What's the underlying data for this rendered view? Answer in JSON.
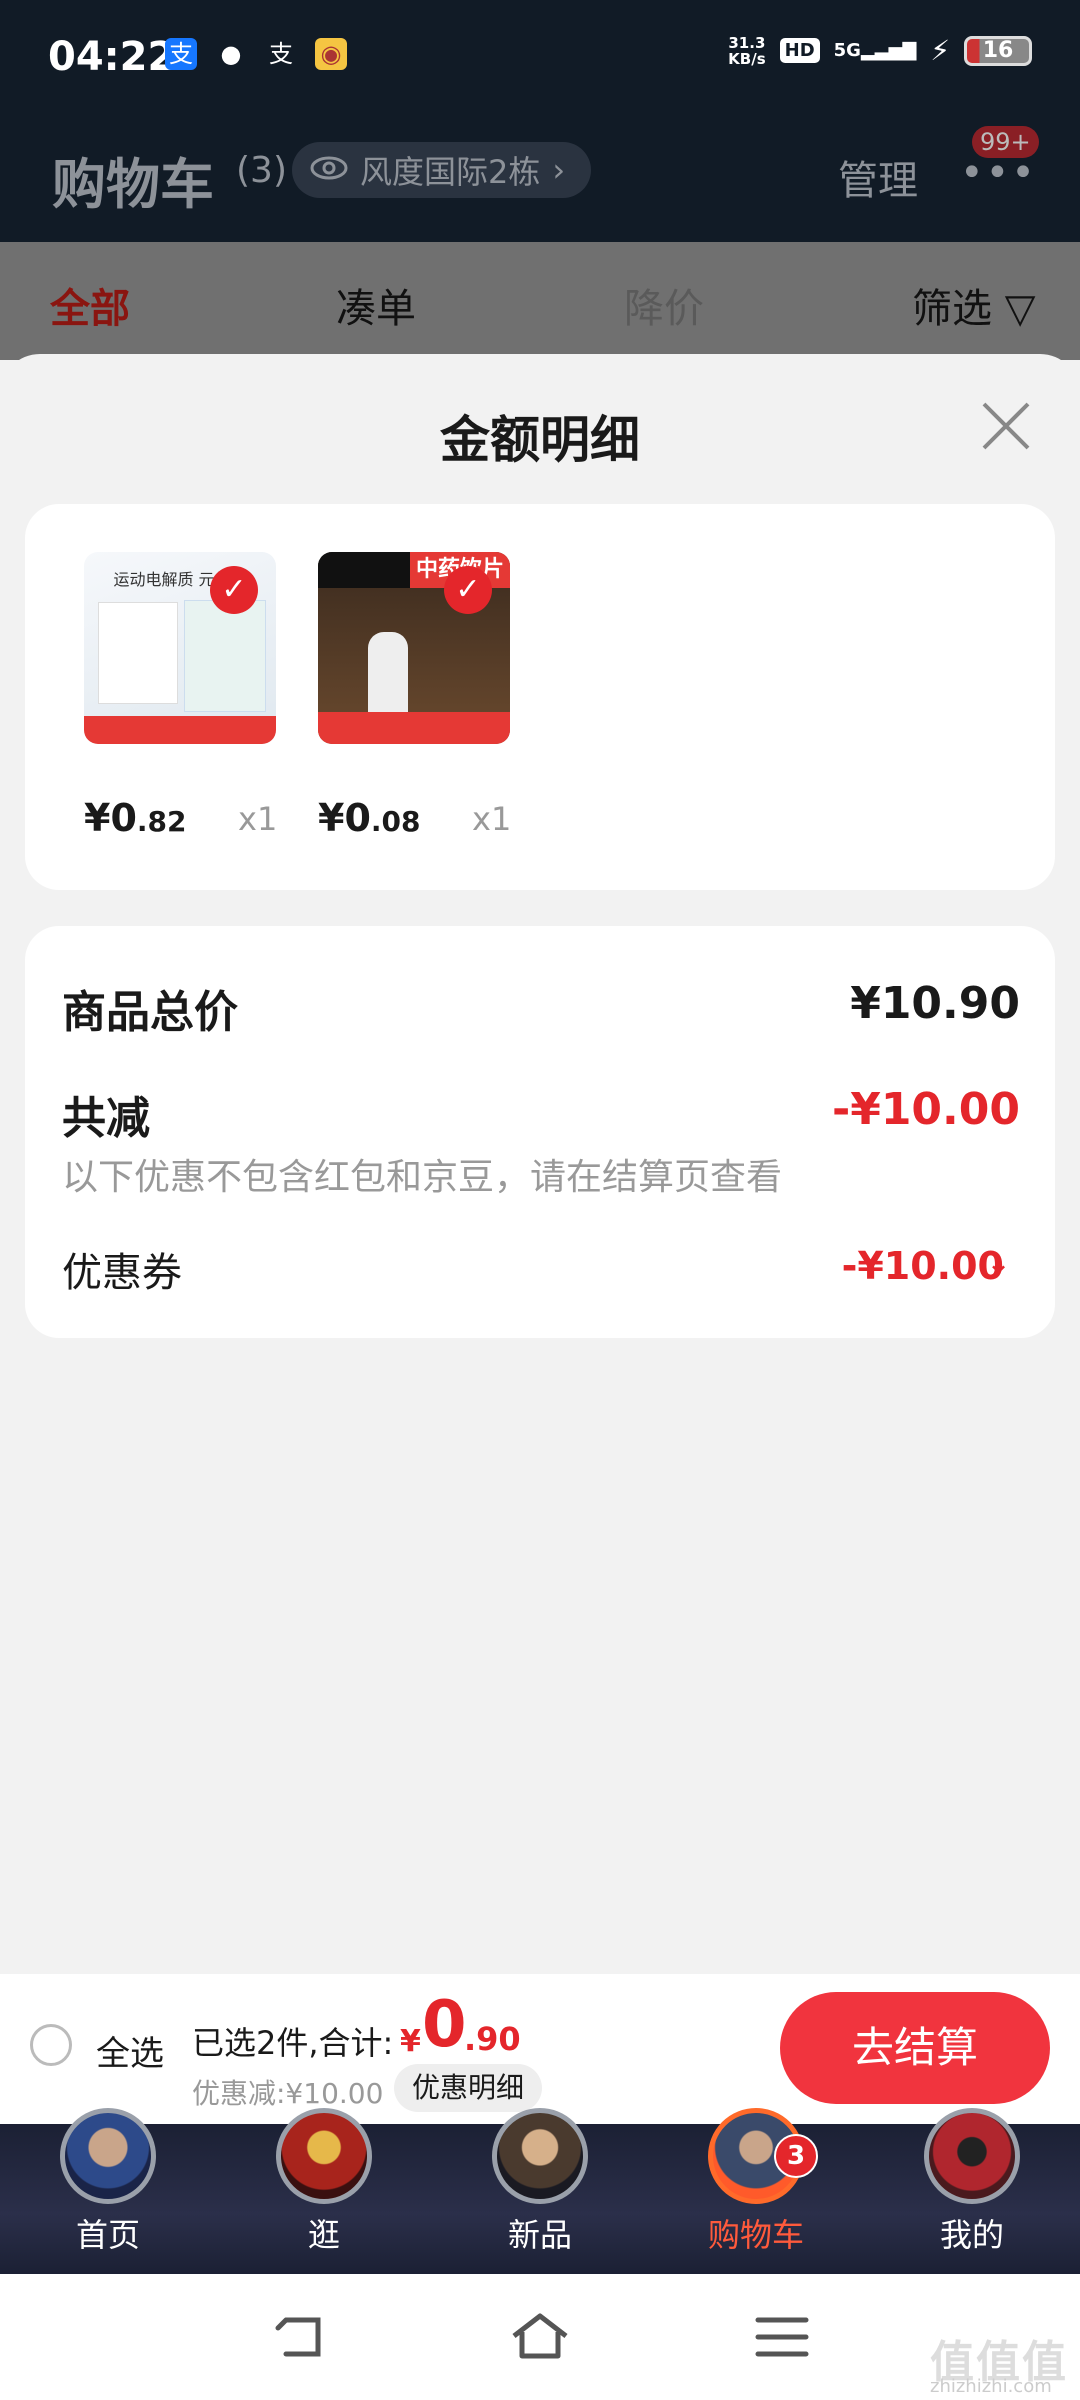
{
  "status_bar": {
    "time": "04:22",
    "net_speed_top": "31.3",
    "net_speed_unit": "KB/s",
    "hd": "HD",
    "signal": "5G",
    "battery": "16"
  },
  "header": {
    "title": "购物车",
    "count": "(3)",
    "address": "风度国际2栋",
    "manage": "管理",
    "more": "•••",
    "badge": "99+"
  },
  "tabs": [
    {
      "label": "全部"
    },
    {
      "label": "凑单"
    },
    {
      "label": "降价"
    },
    {
      "label": "筛选"
    }
  ],
  "sheet": {
    "title": "金额明细",
    "items": [
      {
        "price_yen": "¥0",
        "price_dec": ".82",
        "qty": "x1",
        "img_label": "运动电解质 元气补"
      },
      {
        "price_yen": "¥0",
        "price_dec": ".08",
        "qty": "x1",
        "img_label": "中药饮片"
      }
    ],
    "summary": {
      "goods_total_label": "商品总价",
      "goods_total": "¥10.90",
      "reduce_label": "共减",
      "reduce_value": "-¥10.00",
      "note": "以下优惠不包含红包和京豆，请在结算页查看",
      "coupon_label": "优惠券",
      "coupon_value": "-¥10.00"
    }
  },
  "checkout": {
    "select_all": "全选",
    "selected_summary": "已选2件,合计:",
    "total_yen": "¥",
    "total_int": "0",
    "total_dec": ".90",
    "discount": "优惠减:¥10.00",
    "detail_button": "优惠明细",
    "checkout_button": "去结算"
  },
  "bottom_nav": [
    {
      "label": "首页"
    },
    {
      "label": "逛"
    },
    {
      "label": "新品"
    },
    {
      "label": "购物车",
      "badge": "3"
    },
    {
      "label": "我的"
    }
  ],
  "watermark": {
    "text": "值值值",
    "sub": "zhizhizhi.com"
  }
}
